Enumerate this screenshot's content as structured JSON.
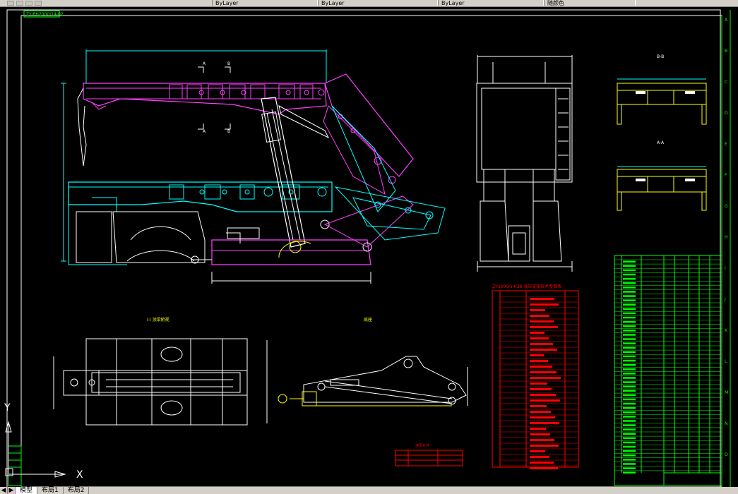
{
  "toolbar": {
    "fields": [
      "ByLayer",
      "ByLayer",
      "ByLayer",
      "随颜色"
    ]
  },
  "drawing": {
    "title_tag": "ZY/PH2000/14-02",
    "section_bb": "B-B",
    "section_aa": "A-A",
    "label_a": "A",
    "label_b": "B",
    "label_top_view": "Ⅰ-Ⅰ 顶梁俯视",
    "label_base_view": "底座",
    "spec_table_title": "ZY3000/14/28 液压支架技术参数表",
    "legend_title": "液压元件",
    "parts_title": "明细表",
    "ucs_x": "X",
    "ucs_y": "Y",
    "border_letters_right": [
      "A",
      "B",
      "C",
      "D",
      "E",
      "F",
      "G",
      "H",
      "I",
      "J",
      "K",
      "L",
      "M",
      "N",
      "O"
    ]
  },
  "tabs": {
    "model": "模型",
    "layout1": "布局1",
    "layout2": "布局2"
  },
  "colors": {
    "background": "#000000",
    "magenta": "#ff40ff",
    "cyan": "#00ffff",
    "yellow": "#ffff00",
    "red": "#ff0000",
    "green": "#00ff00",
    "white": "#ffffff",
    "blue": "#4040ff"
  }
}
